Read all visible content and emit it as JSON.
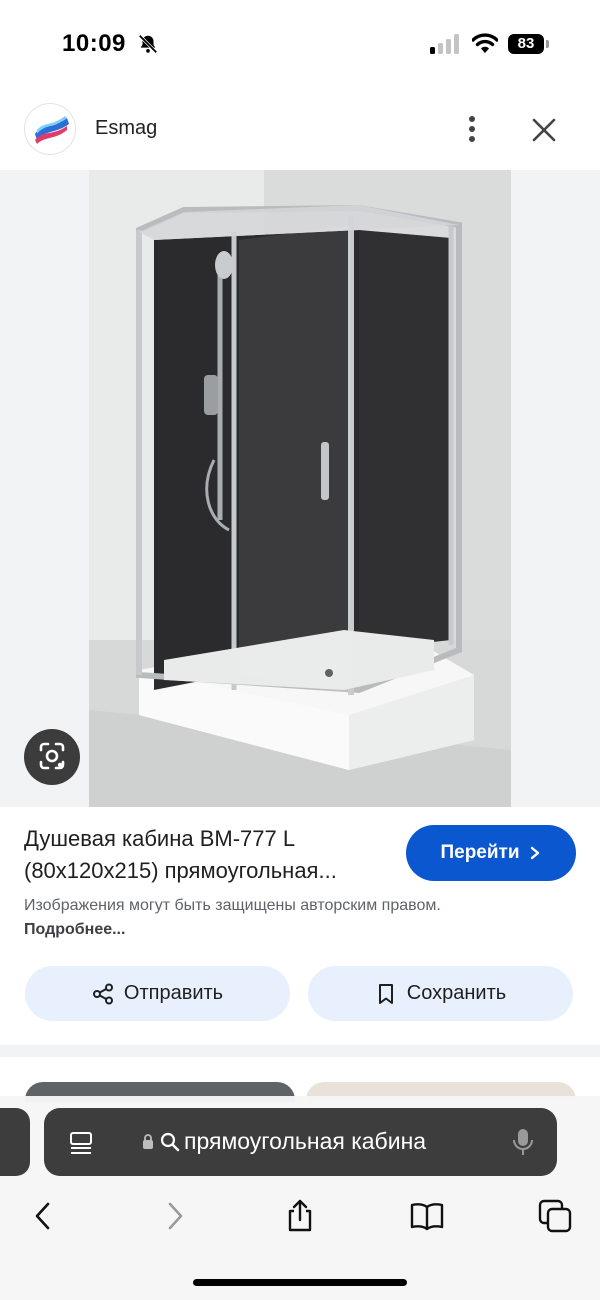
{
  "status_bar": {
    "time": "10:09",
    "battery": "83",
    "icons": [
      "bell-slash-icon",
      "cellular-signal-icon",
      "wifi-icon",
      "battery-icon"
    ]
  },
  "site": {
    "name": "Esmag",
    "logo_icon": "esmag-logo-icon",
    "more_icon": "more-vert-icon",
    "close_icon": "close-icon"
  },
  "image": {
    "subject": "shower-cabin-photo",
    "lens_icon": "camera-lens-icon"
  },
  "result": {
    "title": "Душевая кабина BM-777 L (80x120x215) прямоугольная...",
    "visit_label": "Перейти",
    "disclaimer": "Изображения могут быть защищены авторским правом.",
    "disclaimer_more": "Подробнее..."
  },
  "actions": {
    "share_label": "Отправить",
    "save_label": "Сохранить"
  },
  "browser": {
    "address_text": "прямоугольная кабина",
    "toolbar_icons": [
      "back-icon",
      "forward-icon",
      "share-icon",
      "bookmarks-icon",
      "tabs-icon"
    ]
  },
  "colors": {
    "accent": "#0b57d0",
    "chip_bg": "#e8f0fe",
    "address_bar_bg": "#3d3d3d"
  }
}
